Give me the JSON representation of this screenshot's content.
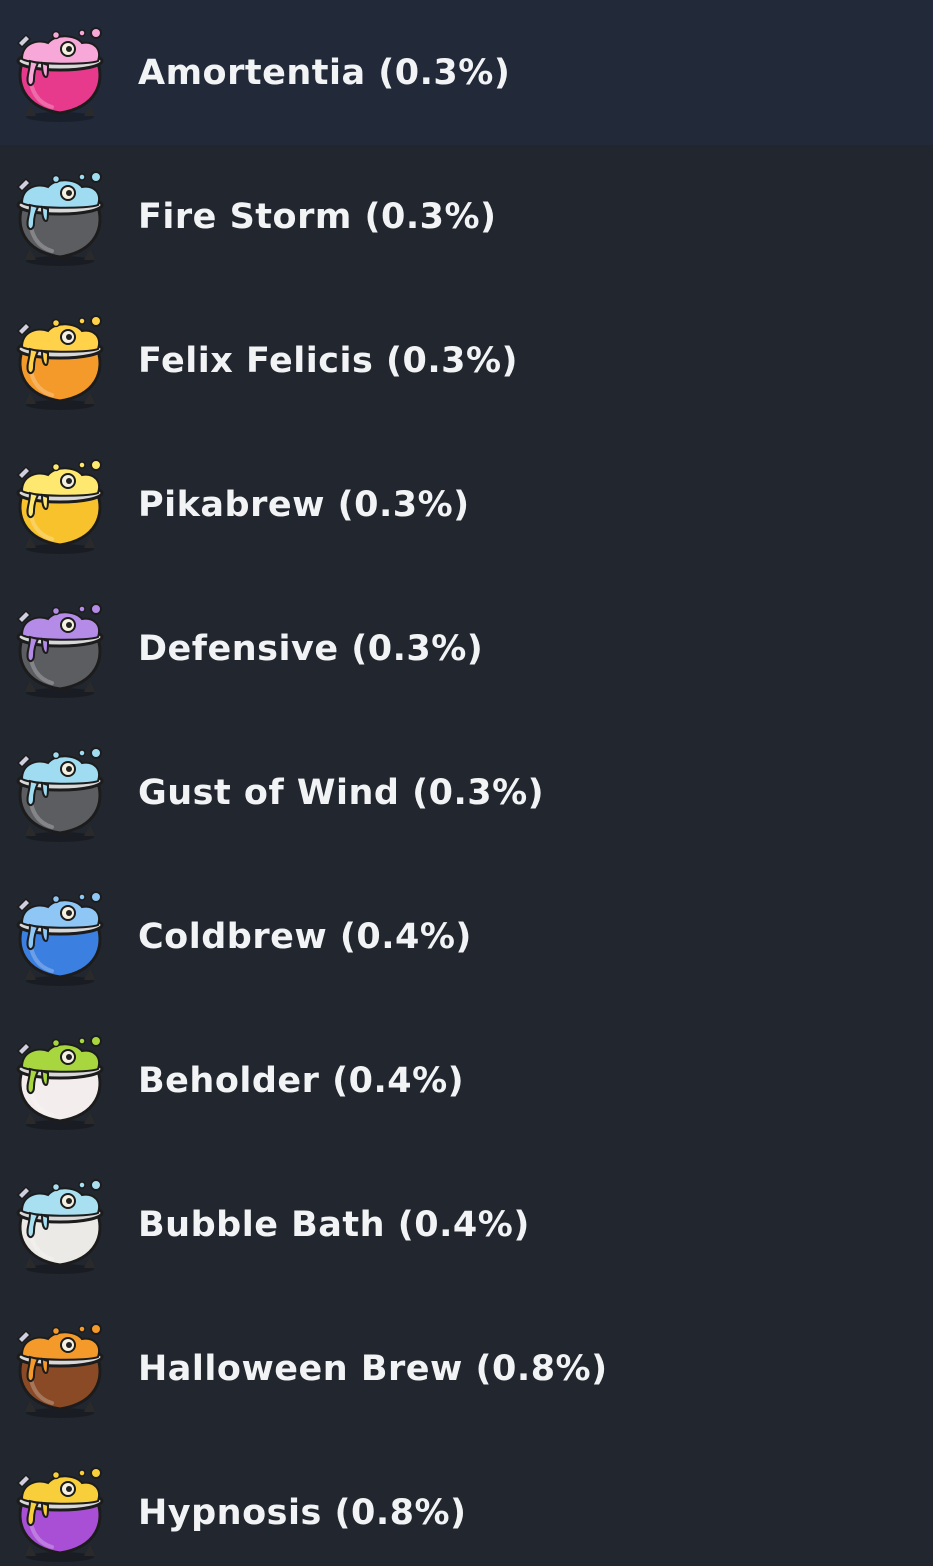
{
  "items": [
    {
      "label": "Amortentia (0.3%)",
      "icon": "pink-love-cauldron-icon",
      "pot": "#e73a8d",
      "liquid": "#f7a8d8",
      "selected": true
    },
    {
      "label": "Fire Storm (0.3%)",
      "icon": "grey-cauldron-fire-rune-icon",
      "pot": "#5b5d60",
      "liquid": "#9fdcf2",
      "selected": false
    },
    {
      "label": "Felix Felicis (0.3%)",
      "icon": "orange-lucky-cauldron-icon",
      "pot": "#f39a2a",
      "liquid": "#ffd24a",
      "selected": false
    },
    {
      "label": "Pikabrew (0.3%)",
      "icon": "yellow-pikabrew-cauldron-icon",
      "pot": "#f8c22d",
      "liquid": "#ffe870",
      "selected": false
    },
    {
      "label": "Defensive (0.3%)",
      "icon": "grey-cauldron-hourglass-rune-icon",
      "pot": "#5b5d60",
      "liquid": "#b58be8",
      "selected": false
    },
    {
      "label": "Gust of Wind (0.3%)",
      "icon": "grey-cauldron-wind-rune-icon",
      "pot": "#5b5d60",
      "liquid": "#9fdcf2",
      "selected": false
    },
    {
      "label": "Coldbrew (0.4%)",
      "icon": "blue-cold-cauldron-icon",
      "pot": "#3b7fe0",
      "liquid": "#8ec6f5",
      "selected": false
    },
    {
      "label": "Beholder (0.4%)",
      "icon": "eyeball-cauldron-icon",
      "pot": "#f3eded",
      "liquid": "#a7d63f",
      "selected": false
    },
    {
      "label": "Bubble Bath (0.4%)",
      "icon": "white-bubble-bath-cauldron-icon",
      "pot": "#eceae6",
      "liquid": "#a8e0f2",
      "selected": false
    },
    {
      "label": "Halloween Brew (0.8%)",
      "icon": "brown-halloween-cauldron-icon",
      "pot": "#8a4a26",
      "liquid": "#f39a2a",
      "selected": false
    },
    {
      "label": "Hypnosis (0.8%)",
      "icon": "purple-hypnosis-cauldron-icon",
      "pot": "#a94fd6",
      "liquid": "#f8cf3a",
      "selected": false
    }
  ]
}
